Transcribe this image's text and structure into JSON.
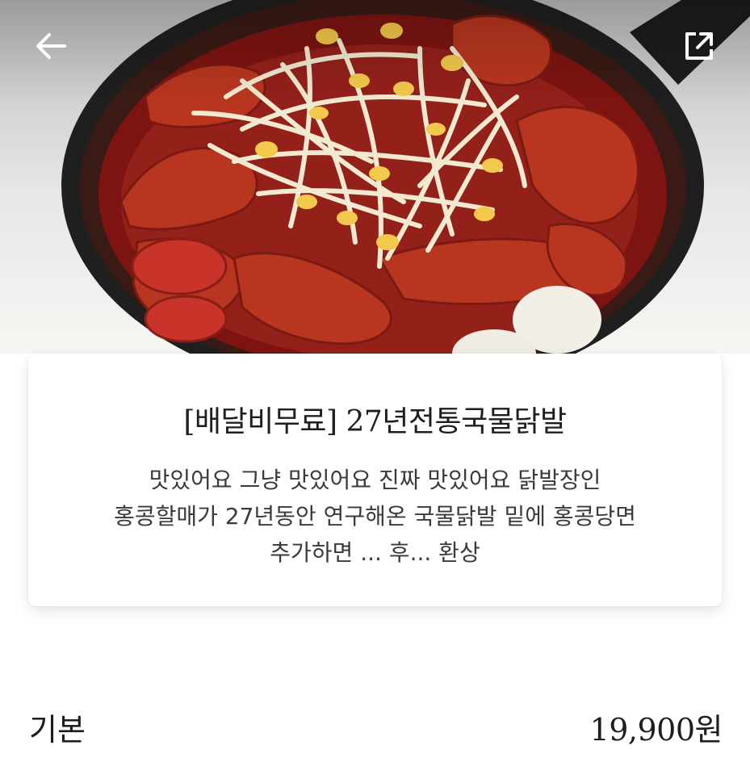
{
  "hero": {
    "image": "food-photo-spicy-chicken-feet-soup"
  },
  "header": {
    "back_icon": "arrow-left-icon",
    "share_icon": "external-share-icon"
  },
  "menu_item": {
    "title": "[배달비무료] 27년전통국물닭발",
    "description_lines": [
      "맛있어요 그냥 맛있어요 진짜 맛있어요 닭발장인",
      "홍콩할매가 27년동안 연구해온 국물닭발 밑에 홍콩당면",
      "추가하면 ... 후... 환상"
    ]
  },
  "option": {
    "name": "기본",
    "price": "19,900원"
  }
}
